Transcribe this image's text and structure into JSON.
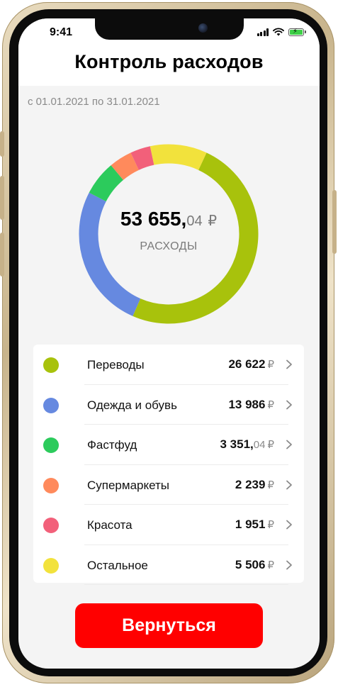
{
  "status": {
    "time": "9:41"
  },
  "header": {
    "title": "Контроль расходов"
  },
  "period": "с 01.01.2021 по 31.01.2021",
  "summary": {
    "total_main": "53 655,",
    "total_cents": "04",
    "currency": "₽",
    "label": "РАСХОДЫ"
  },
  "categories": [
    {
      "name": "Переводы",
      "amount_main": "26 622",
      "amount_cents": "",
      "currency": "₽",
      "value": 26622,
      "color": "#A8C20C"
    },
    {
      "name": "Одежда и обувь",
      "amount_main": "13 986",
      "amount_cents": "",
      "currency": "₽",
      "value": 13986,
      "color": "#6689E0"
    },
    {
      "name": "Фастфуд",
      "amount_main": "3 351,",
      "amount_cents": "04",
      "currency": "₽",
      "value": 3351.04,
      "color": "#2CCB5C"
    },
    {
      "name": "Супермаркеты",
      "amount_main": "2 239",
      "amount_cents": "",
      "currency": "₽",
      "value": 2239,
      "color": "#FF8A5C"
    },
    {
      "name": "Красота",
      "amount_main": "1 951",
      "amount_cents": "",
      "currency": "₽",
      "value": 1951,
      "color": "#F2607A"
    },
    {
      "name": "Остальное",
      "amount_main": "5 506",
      "amount_cents": "",
      "currency": "₽",
      "value": 5506,
      "color": "#F2E23C"
    }
  ],
  "actions": {
    "back_label": "Вернуться",
    "back_color": "#FF0000"
  }
}
